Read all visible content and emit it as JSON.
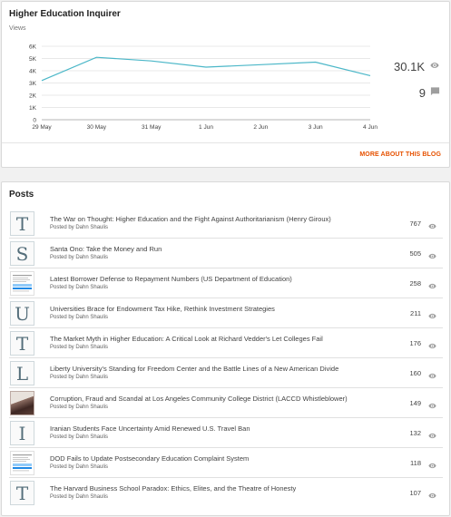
{
  "blog": {
    "title": "Higher Education Inquirer",
    "chart_label": "Views",
    "views_total": "30.1K",
    "comments_total": "9",
    "more_link": "MORE ABOUT THIS BLOG"
  },
  "chart_data": {
    "type": "line",
    "x": [
      "29 May",
      "30 May",
      "31 May",
      "1 Jun",
      "2 Jun",
      "3 Jun",
      "4 Jun"
    ],
    "values": [
      3200,
      5100,
      4800,
      4300,
      4500,
      4700,
      3600
    ],
    "y_ticks": [
      "0",
      "1K",
      "2K",
      "3K",
      "4K",
      "5K",
      "6K"
    ],
    "ylim": [
      0,
      6000
    ],
    "grid": true,
    "xlabel": "",
    "ylabel": "Views",
    "colors": {
      "line": "#4bb7c8",
      "grid": "#e0e0e0"
    }
  },
  "posts_section": {
    "title": "Posts",
    "items": [
      {
        "thumb": "T",
        "title": "The War on Thought: Higher Education and the Fight Against Authoritarianism (Henry Giroux)",
        "author": "Posted by Dahn Shaulis",
        "views": "767"
      },
      {
        "thumb": "S",
        "title": "Santa Ono: Take the Money and Run",
        "author": "Posted by Dahn Shaulis",
        "views": "505"
      },
      {
        "thumb": "doc",
        "title": "Latest Borrower Defense to Repayment Numbers (US Department of Education)",
        "author": "Posted by Dahn Shaulis",
        "views": "258"
      },
      {
        "thumb": "U",
        "title": "Universities Brace for Endowment Tax Hike, Rethink Investment Strategies",
        "author": "Posted by Dahn Shaulis",
        "views": "211"
      },
      {
        "thumb": "T",
        "title": "The Market Myth in Higher Education: A Critical Look at Richard Vedder's Let Colleges Fail",
        "author": "Posted by Dahn Shaulis",
        "views": "176"
      },
      {
        "thumb": "L",
        "title": "Liberty University's Standing for Freedom Center and the Battle Lines of a New American Divide",
        "author": "Posted by Dahn Shaulis",
        "views": "160"
      },
      {
        "thumb": "photo",
        "title": "Corruption, Fraud and Scandal at Los Angeles Community College District (LACCD Whistleblower)",
        "author": "Posted by Dahn Shaulis",
        "views": "149"
      },
      {
        "thumb": "I",
        "title": "Iranian Students Face Uncertainty Amid Renewed U.S. Travel Ban",
        "author": "Posted by Dahn Shaulis",
        "views": "132"
      },
      {
        "thumb": "doc",
        "title": "DOD Fails to Update Postsecondary Education Complaint System",
        "author": "Posted by Dahn Shaulis",
        "views": "118"
      },
      {
        "thumb": "T",
        "title": "The Harvard Business School Paradox: Ethics, Elites, and the Theatre of Honesty",
        "author": "Posted by Dahn Shaulis",
        "views": "107"
      }
    ]
  },
  "icons": {
    "views": "eye-icon",
    "comments": "comment-icon"
  }
}
